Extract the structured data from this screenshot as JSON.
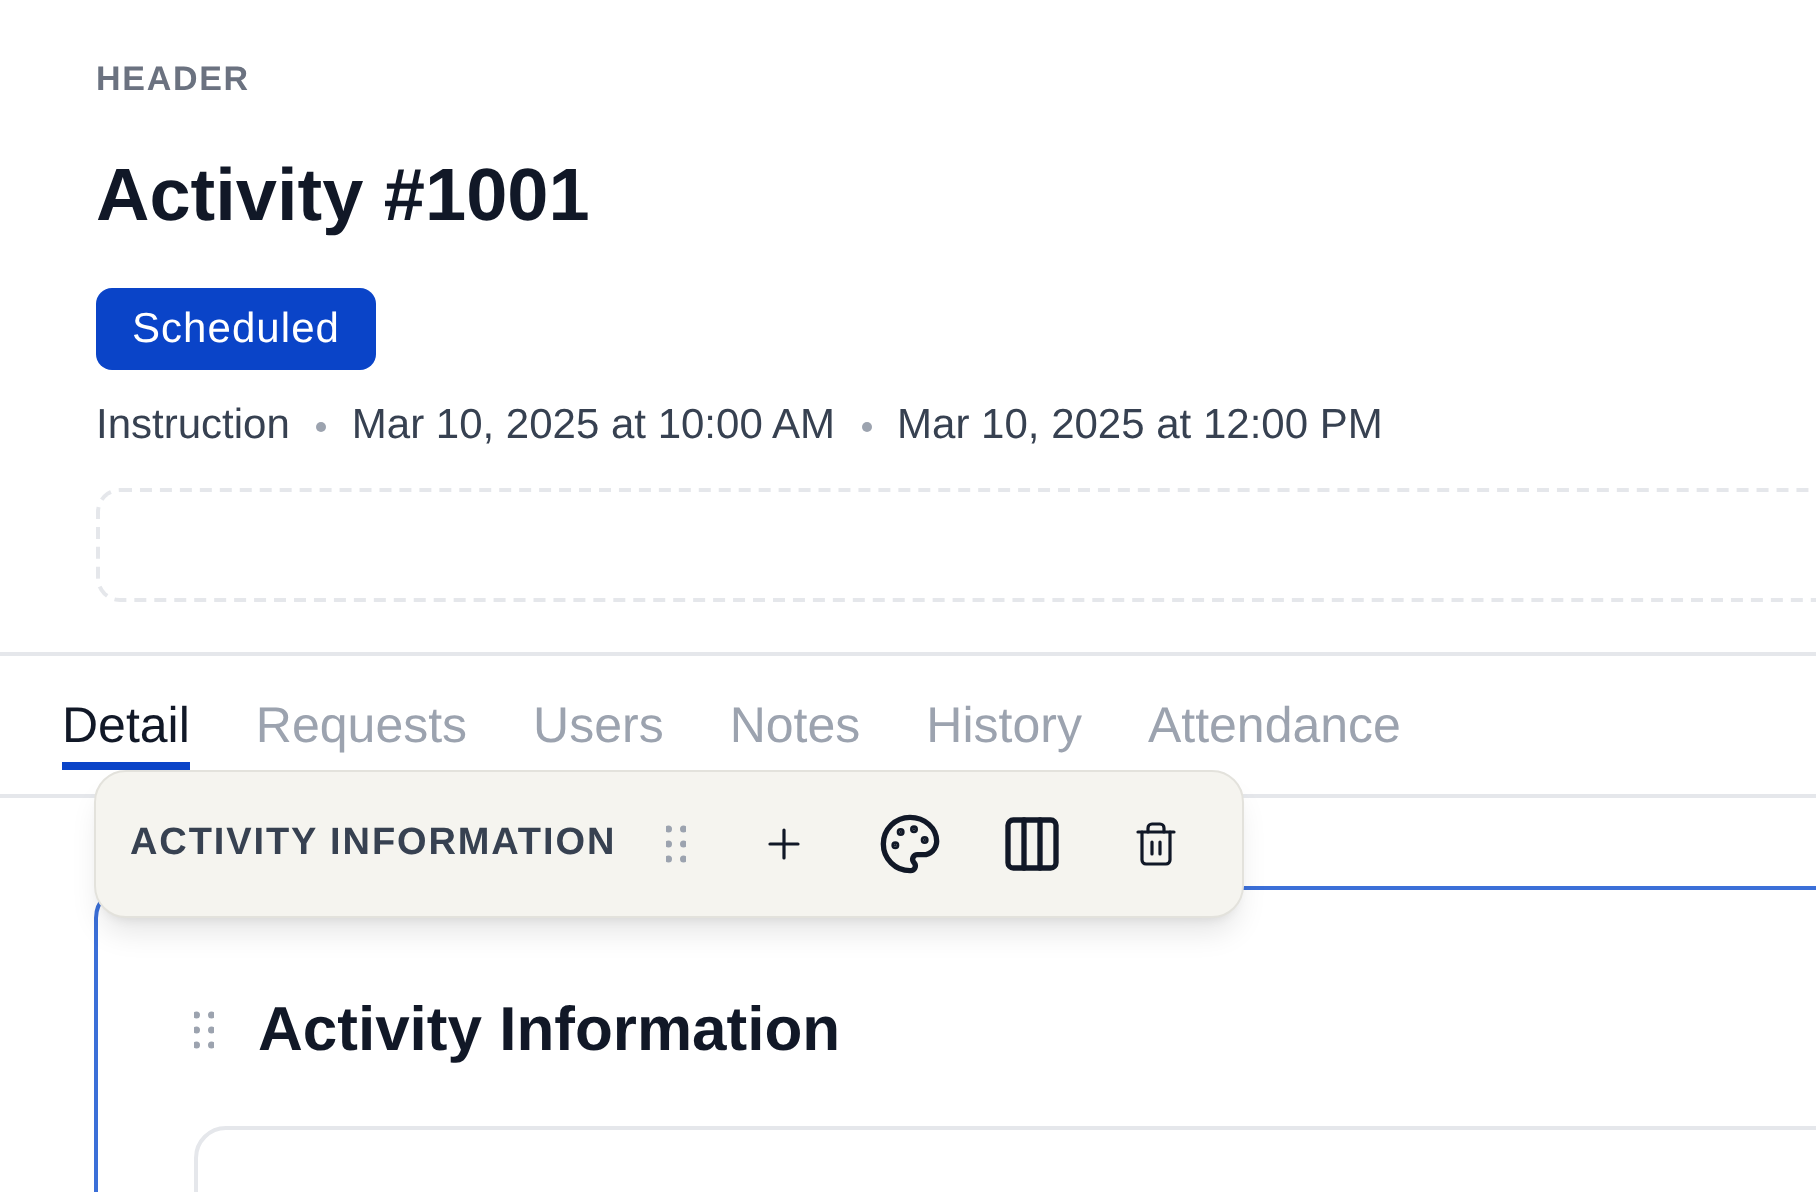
{
  "section_label": "HEADER",
  "title": "Activity #1001",
  "status_badge": "Scheduled",
  "meta": [
    "Instruction",
    "Mar 10, 2025 at 10:00 AM",
    "Mar 10, 2025 at 12:00 PM"
  ],
  "tabs": [
    {
      "label": "Detail",
      "selected": true
    },
    {
      "label": "Requests",
      "selected": false
    },
    {
      "label": "Users",
      "selected": false
    },
    {
      "label": "Notes",
      "selected": false
    },
    {
      "label": "History",
      "selected": false
    },
    {
      "label": "Attendance",
      "selected": false
    }
  ],
  "toolbar": {
    "label": "ACTIVITY INFORMATION"
  },
  "section": {
    "title": "Activity Information"
  }
}
